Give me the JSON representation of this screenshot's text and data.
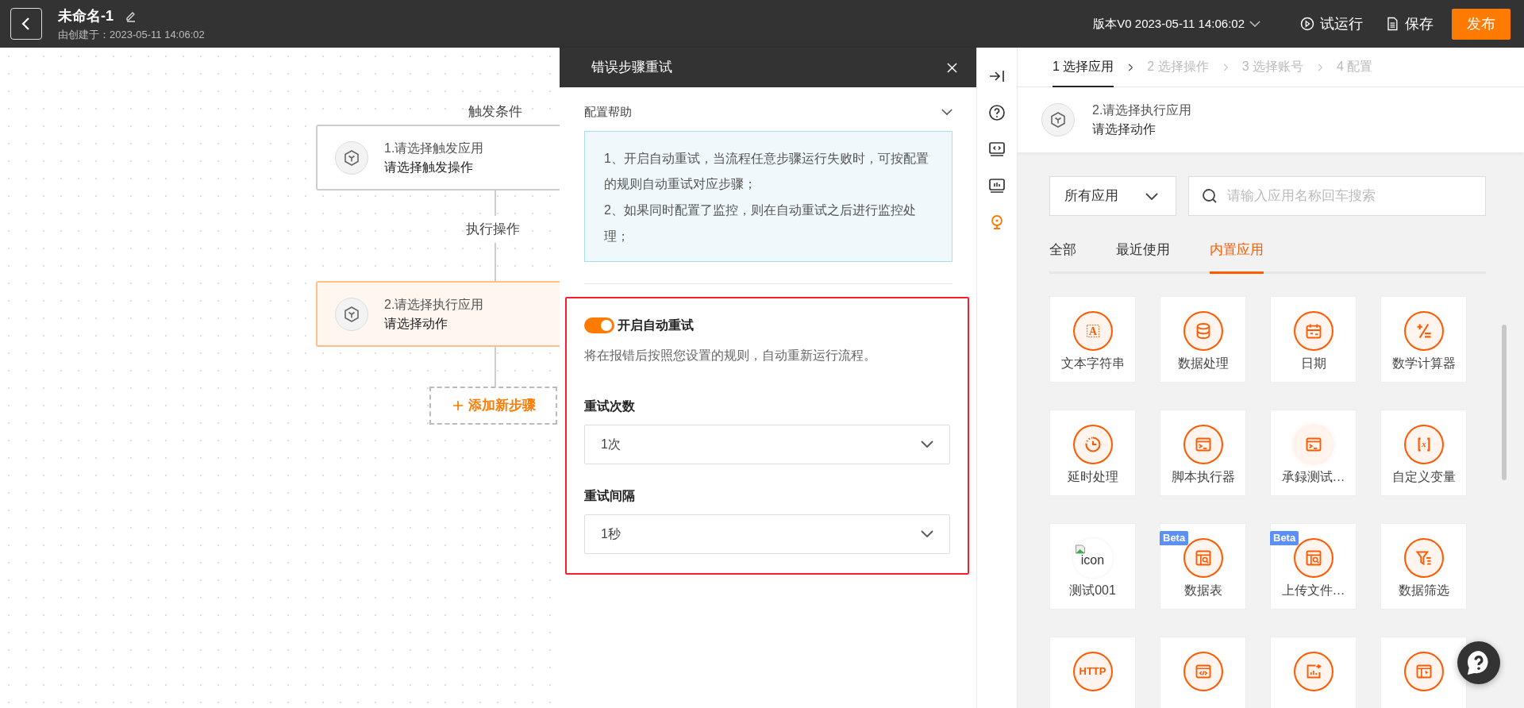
{
  "header": {
    "title": "未命名-1",
    "subtitle": "由创建于：2023-05-11 14:06:02",
    "version": "版本V0 2023-05-11 14:06:02",
    "buttons": [
      {
        "label": "试运行",
        "kind": "run"
      },
      {
        "label": "保存",
        "kind": "save"
      },
      {
        "label": "发布",
        "kind": "primary"
      }
    ]
  },
  "canvas": {
    "trigger_label": "触发条件",
    "action_label": "执行操作",
    "add_step": "添加新步骤",
    "nodes": [
      {
        "title": "1.请选择触发应用",
        "subtitle": "请选择触发操作",
        "selected": false
      },
      {
        "title": "2.请选择执行应用",
        "subtitle": "请选择动作",
        "selected": true
      }
    ]
  },
  "panel": {
    "title": "错误步骤重试",
    "help_title": "配置帮助",
    "help_lines": [
      "1、开启自动重试，当流程任意步骤运行失败时，可按配置的规则自动重试对应步骤；",
      "2、如果同时配置了监控，则在自动重试之后进行监控处理；"
    ],
    "retry": {
      "on": true,
      "label": "开启自动重试",
      "description": "将在报错后按照您设置的规则，自动重新运行流程。",
      "fields": [
        {
          "label": "重试次数",
          "value": "1次"
        },
        {
          "label": "重试间隔",
          "value": "1秒"
        }
      ]
    }
  },
  "side_tools": [
    {
      "kind": "collapse",
      "selected": false
    },
    {
      "kind": "help",
      "selected": false
    },
    {
      "kind": "code",
      "selected": false
    },
    {
      "kind": "monitor",
      "selected": false
    },
    {
      "kind": "bulb",
      "selected": true
    }
  ],
  "steps": [
    {
      "label": "1 选择应用",
      "selected": true
    },
    {
      "label": "2 选择操作",
      "selected": false
    },
    {
      "label": "3 选择账号",
      "selected": false
    },
    {
      "label": "4 配置",
      "selected": false
    }
  ],
  "selected_app": {
    "title": "2.请选择执行应用",
    "subtitle": "请选择动作"
  },
  "filter": {
    "category": "所有应用",
    "search_placeholder": "请输入应用名称回车搜索"
  },
  "app_tabs": [
    {
      "label": "全部",
      "selected": false
    },
    {
      "label": "最近使用",
      "selected": false
    },
    {
      "label": "内置应用",
      "selected": true
    }
  ],
  "apps": [
    {
      "name": "文本字符串",
      "kind": "text",
      "icon_text": "A"
    },
    {
      "name": "数据处理",
      "kind": "database"
    },
    {
      "name": "日期",
      "kind": "calendar"
    },
    {
      "name": "数学计算器",
      "kind": "math"
    },
    {
      "name": "延时处理",
      "kind": "clock"
    },
    {
      "name": "脚本执行器",
      "kind": "terminal"
    },
    {
      "name": "承録测试…",
      "kind": "terminal-soft"
    },
    {
      "name": "自定义变量",
      "kind": "variable",
      "icon_text": "x"
    },
    {
      "name": "测试001",
      "kind": "broken-image",
      "icon_text": "icon"
    },
    {
      "name": "数据表",
      "kind": "table-search",
      "badge": "Beta"
    },
    {
      "name": "上传文件…",
      "kind": "table-search",
      "badge": "Beta"
    },
    {
      "name": "数据筛选",
      "kind": "filter"
    },
    {
      "kind": "http",
      "icon_text": "HTTP"
    },
    {
      "kind": "code-window"
    },
    {
      "kind": "chart-export"
    },
    {
      "kind": "window-cursor"
    }
  ]
}
